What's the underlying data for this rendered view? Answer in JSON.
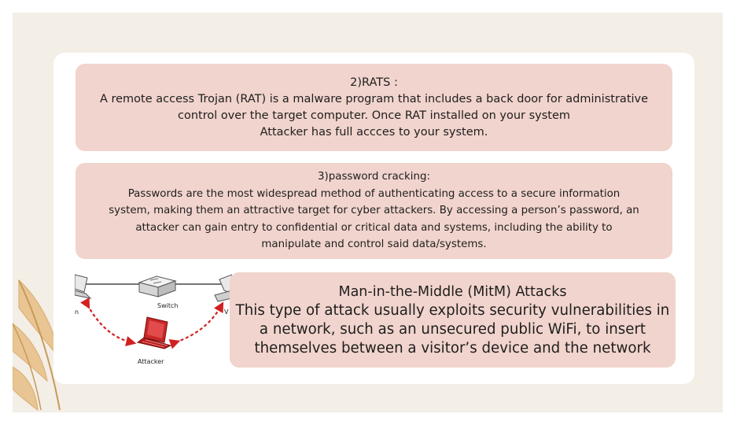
{
  "rats": {
    "heading": "2)RATS :",
    "line1": "A remote access Trojan (RAT) is a malware program that includes a back door for administrative",
    "line2": "control over the target computer. Once RAT installed on your system",
    "line3": "Attacker has full accces to your system."
  },
  "password": {
    "heading": "3)password cracking:",
    "line1": "Passwords are the most widespread method of authenticating access to a secure information",
    "line2": "system, making them an attractive target for cyber attackers. By accessing a person’s password, an",
    "line3": "attacker can gain entry to confidential or critical data and systems, including the ability to",
    "line4": "manipulate and control said data/systems."
  },
  "mitm": {
    "heading": "Man-in-the-Middle (MitM) Attacks",
    "line1": "This type of attack usually exploits security vulnerabilities in",
    "line2": "a network, such as an unsecured public WiFi, to insert",
    "line3": "themselves between a visitor’s device and the network"
  },
  "diagram": {
    "switch_label": "Switch",
    "attacker_label": "Attacker",
    "left_fragment": "n",
    "right_fragment": "V"
  },
  "colors": {
    "background": "#f3eee6",
    "card": "#ffffff",
    "box": "#f1d4cd",
    "leaf": "#e8c593",
    "arrow": "#d32020",
    "laptop": "#c62828"
  },
  "icons": {
    "switch": "network-switch-icon",
    "attacker": "laptop-icon",
    "leaf": "palm-leaf-decoration"
  }
}
